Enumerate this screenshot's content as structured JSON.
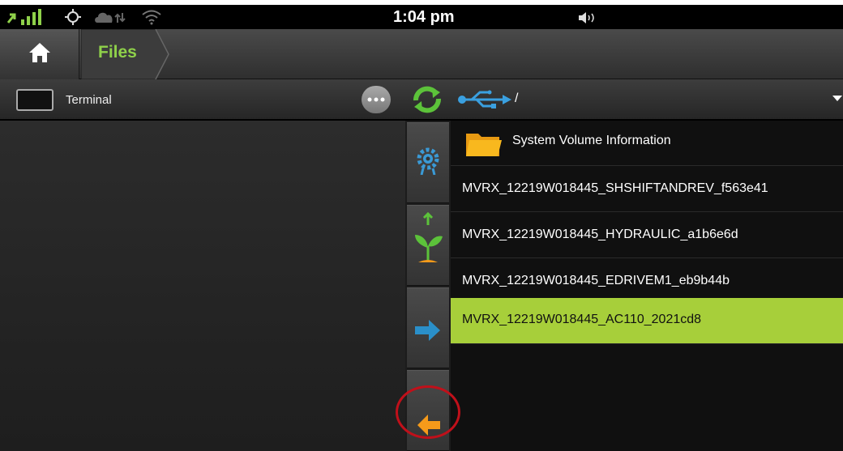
{
  "status_bar": {
    "time": "1:04 pm",
    "icons": [
      "signal-icon",
      "gps-icon",
      "cloud-sync-icon",
      "wifi-icon",
      "volume-icon"
    ]
  },
  "header": {
    "home_icon": "home-icon",
    "breadcrumb": "Files"
  },
  "toolbar": {
    "terminal_label": "Terminal",
    "more_icon": "more-icon",
    "sync_icon": "sync-icon",
    "source_icon": "usb-icon",
    "path": "/"
  },
  "actions": [
    {
      "name": "settings-action",
      "icon": "gear-icon"
    },
    {
      "name": "upload-plant-action",
      "icon": "plant-upload-icon"
    },
    {
      "name": "export-action",
      "icon": "arrow-right-icon"
    },
    {
      "name": "back-action",
      "icon": "arrow-left-icon"
    }
  ],
  "files": [
    {
      "type": "folder",
      "name": "System Volume Information"
    },
    {
      "type": "file",
      "name": "MVRX_12219W018445_SHSHIFTANDREV_f563e41"
    },
    {
      "type": "file",
      "name": "MVRX_12219W018445_HYDRAULIC_a1b6e6d"
    },
    {
      "type": "file",
      "name": "MVRX_12219W018445_EDRIVEM1_eb9b44b"
    },
    {
      "type": "file",
      "name": "MVRX_12219W018445_AC110_2021cd8",
      "selected": true
    }
  ],
  "colors": {
    "accent_green": "#8fd14a",
    "selection_green": "#a7cf3a",
    "annotation_red": "#c0101a",
    "arrow_orange": "#f59a1a",
    "arrow_blue": "#2a8fc9"
  }
}
